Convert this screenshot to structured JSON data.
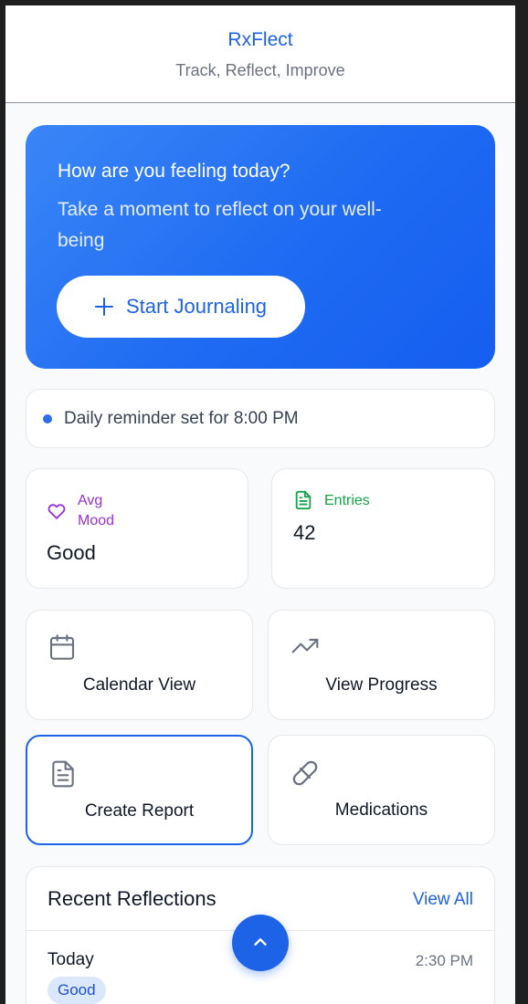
{
  "header": {
    "title": "RxFlect",
    "subtitle": "Track, Reflect, Improve"
  },
  "hero": {
    "question": "How are you feeling today?",
    "subtext": "Take a moment to reflect on your well-being",
    "button_label": "Start Journaling",
    "button_icon": "plus-icon"
  },
  "reminder": {
    "text": "Daily reminder set for 8:00 PM"
  },
  "stats": {
    "mood": {
      "label": "Avg Mood",
      "value": "Good",
      "icon": "heart-icon",
      "color": "#9b30d9"
    },
    "entries": {
      "label": "Entries",
      "value": "42",
      "icon": "document-icon",
      "color": "#16a34a"
    }
  },
  "actions": [
    {
      "label": "Calendar View",
      "icon": "calendar-icon"
    },
    {
      "label": "View Progress",
      "icon": "trending-up-icon"
    },
    {
      "label": "Create Report",
      "icon": "report-icon",
      "selected": true
    },
    {
      "label": "Medications",
      "icon": "pill-icon"
    }
  ],
  "recent": {
    "title": "Recent Reflections",
    "view_all": "View All",
    "entries": [
      {
        "day": "Today",
        "time": "2:30 PM",
        "mood": "Good"
      }
    ]
  },
  "fab": {
    "icon": "chevron-up-icon"
  },
  "colors": {
    "accent": "#1d63e8",
    "hero_start": "#3a86f7",
    "hero_end": "#155ef0",
    "badge_bg": "#dbe7fb"
  }
}
